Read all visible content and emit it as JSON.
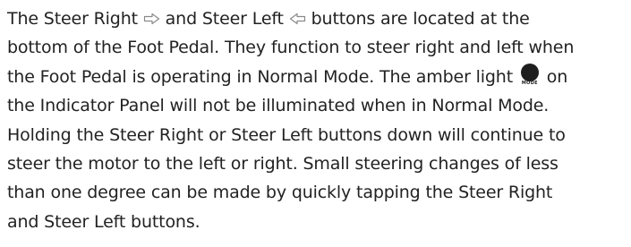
{
  "paragraph": {
    "line1_a": "The Steer Right ",
    "line1_b": " and Steer Left ",
    "line1_c": " buttons are located at the",
    "line2": "bottom of the Foot Pedal. They function to steer right and left when",
    "line3_a": "the Foot Pedal is operating in Normal Mode. The amber light ",
    "line3_b": " on",
    "line4": "the Indicator Panel will not be illuminated when in Normal Mode.",
    "line5": "Holding the Steer Right or Steer Left buttons down will continue to",
    "line6": "steer the motor to the left or right. Small steering changes of less",
    "line7": "than one degree can be made by quickly tapping the Steer Right",
    "line8": "and Steer Left buttons."
  },
  "icons": {
    "steer_right": "steer-right-arrow-icon",
    "steer_left": "steer-left-arrow-icon",
    "mode_light": "mode-indicator-light-icon",
    "mode_light_label": "MODE"
  },
  "colors": {
    "text": "#222222",
    "icon_outline": "#8a8a8a",
    "mode_light": "#1e1e1e"
  }
}
